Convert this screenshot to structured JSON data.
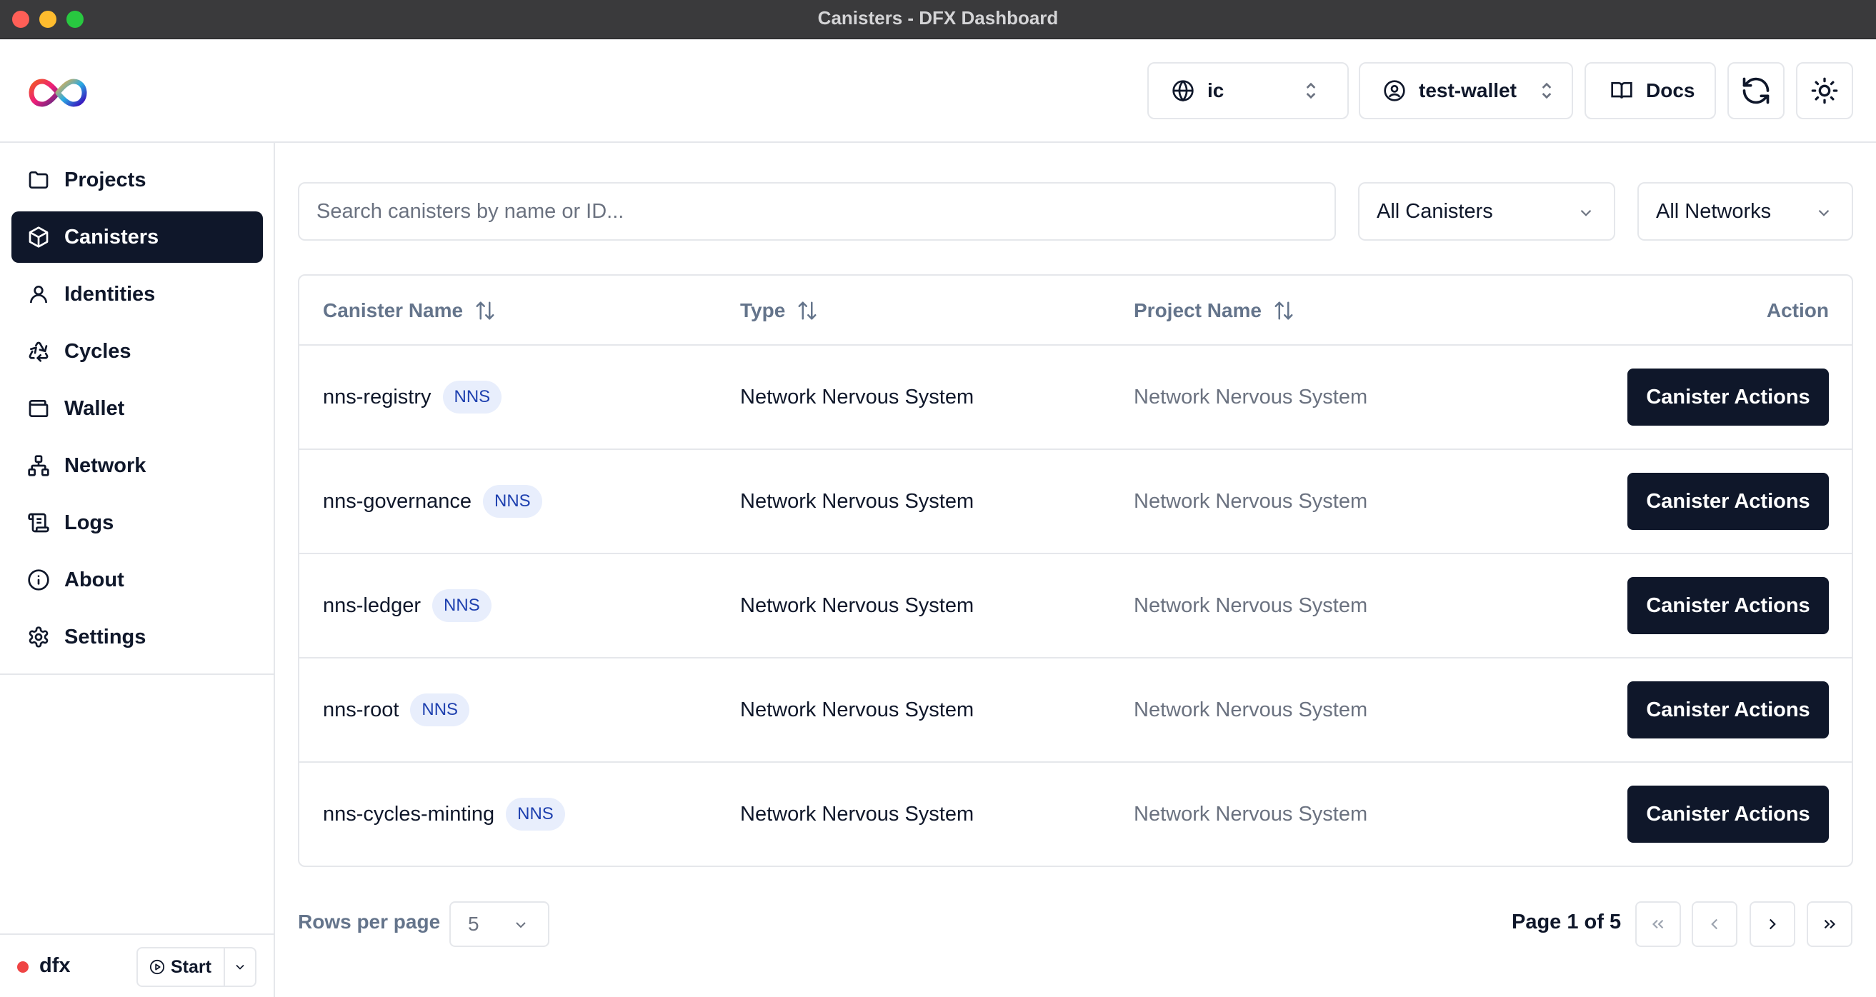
{
  "window": {
    "title": "Canisters - DFX Dashboard"
  },
  "header": {
    "network": "ic",
    "identity": "test-wallet",
    "docs_label": "Docs",
    "logo_icon": "infinity-logo-icon"
  },
  "sidebar": {
    "items": [
      {
        "label": "Projects",
        "icon": "folder-icon"
      },
      {
        "label": "Canisters",
        "icon": "box-icon",
        "active": true
      },
      {
        "label": "Identities",
        "icon": "user-icon"
      },
      {
        "label": "Cycles",
        "icon": "recycle-icon"
      },
      {
        "label": "Wallet",
        "icon": "wallet-icon"
      },
      {
        "label": "Network",
        "icon": "network-icon"
      },
      {
        "label": "Logs",
        "icon": "logs-icon"
      },
      {
        "label": "About",
        "icon": "info-icon"
      },
      {
        "label": "Settings",
        "icon": "gear-icon"
      }
    ],
    "footer": {
      "label": "dfx",
      "status_color": "#ef4444",
      "start_label": "Start"
    }
  },
  "filters": {
    "search_placeholder": "Search canisters by name or ID...",
    "canister_filter": "All Canisters",
    "network_filter": "All Networks"
  },
  "table": {
    "columns": [
      "Canister Name",
      "Type",
      "Project Name",
      "Action"
    ],
    "rows": [
      {
        "name": "nns-registry",
        "badge": "NNS",
        "type": "Network Nervous System",
        "project": "Network Nervous System",
        "action": "Canister Actions"
      },
      {
        "name": "nns-governance",
        "badge": "NNS",
        "type": "Network Nervous System",
        "project": "Network Nervous System",
        "action": "Canister Actions"
      },
      {
        "name": "nns-ledger",
        "badge": "NNS",
        "type": "Network Nervous System",
        "project": "Network Nervous System",
        "action": "Canister Actions"
      },
      {
        "name": "nns-root",
        "badge": "NNS",
        "type": "Network Nervous System",
        "project": "Network Nervous System",
        "action": "Canister Actions"
      },
      {
        "name": "nns-cycles-minting",
        "badge": "NNS",
        "type": "Network Nervous System",
        "project": "Network Nervous System",
        "action": "Canister Actions"
      }
    ]
  },
  "pagination": {
    "rows_label": "Rows per page",
    "rows_value": "5",
    "page_label": "Page 1 of 5"
  },
  "colors": {
    "accent": "#0f172a",
    "badge_bg": "#e8eefc",
    "badge_text": "#1e40af"
  }
}
